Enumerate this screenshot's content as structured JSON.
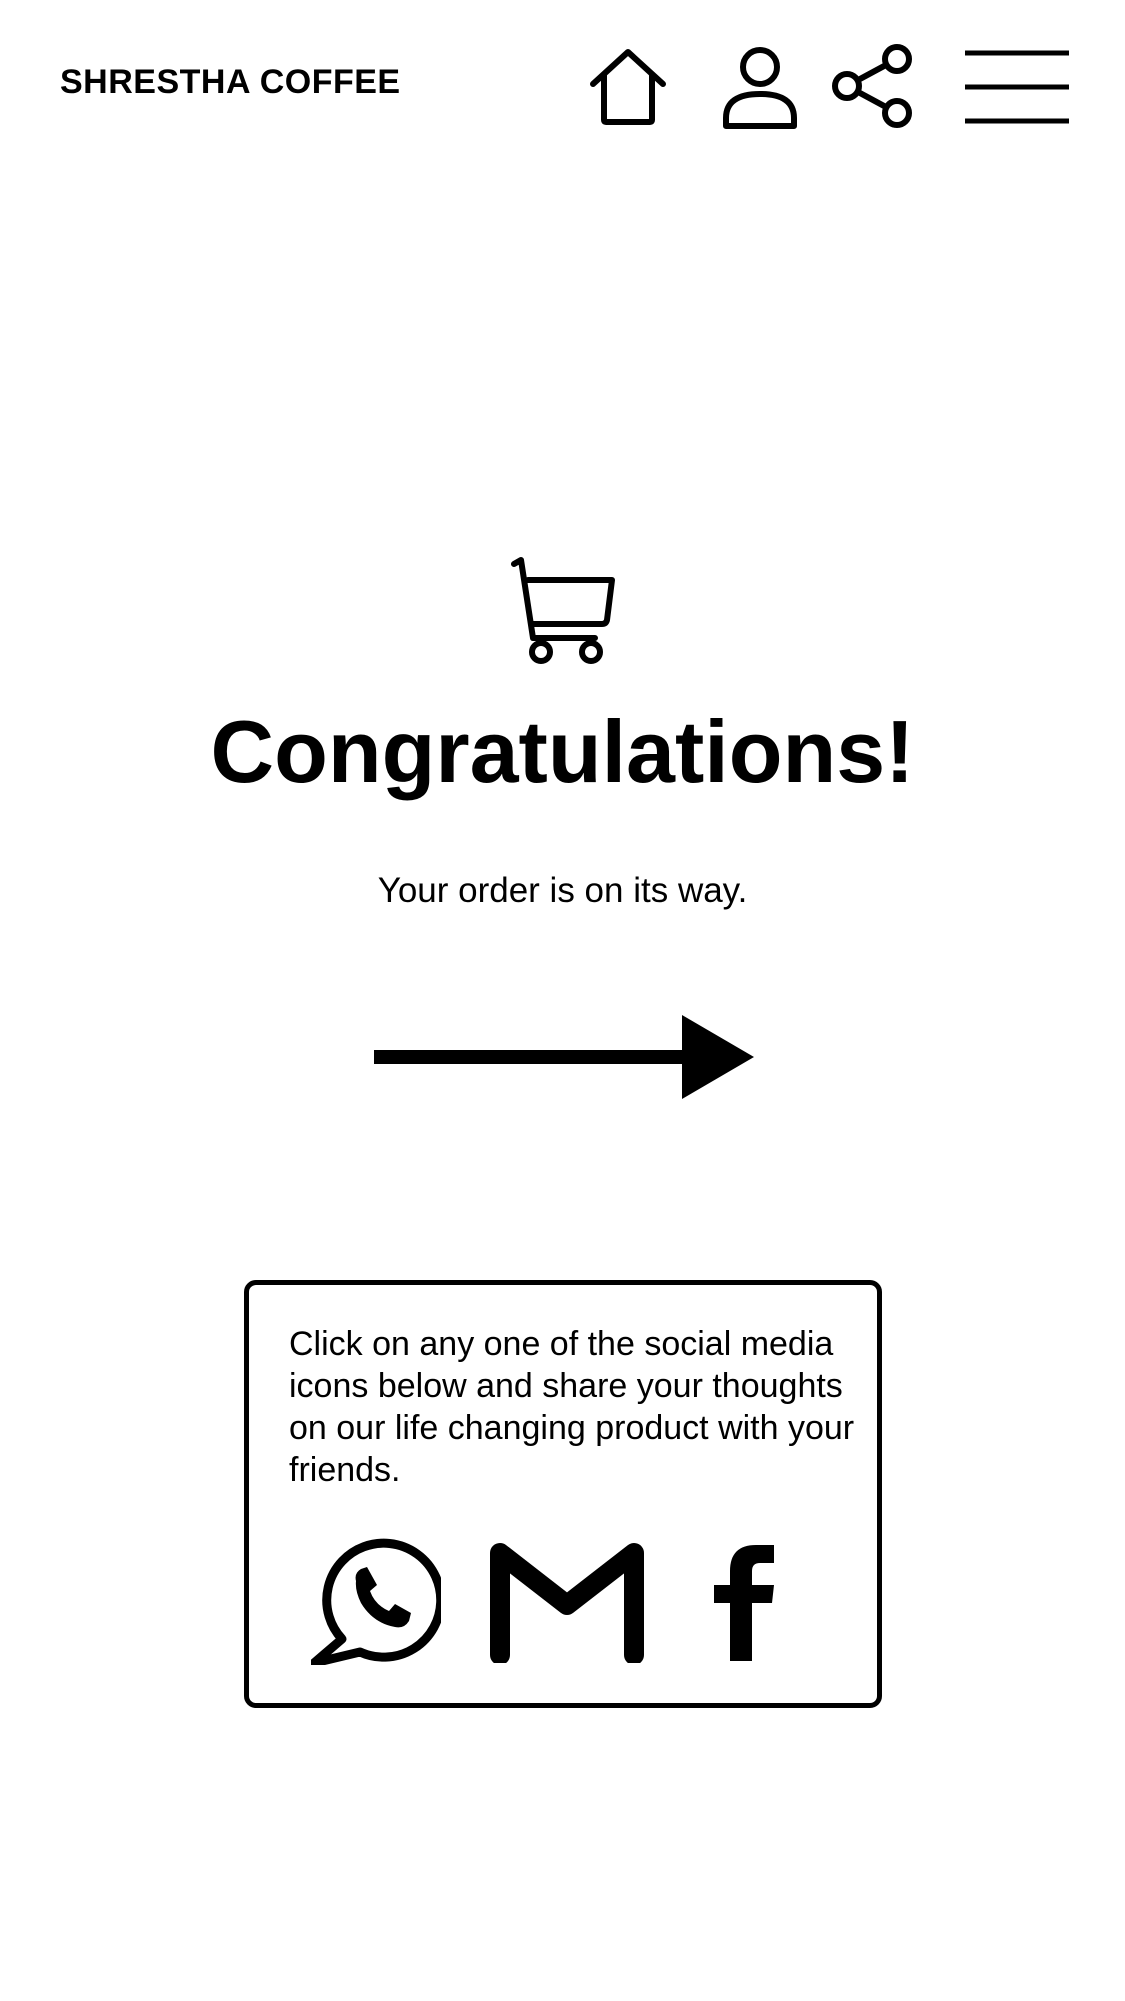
{
  "header": {
    "brand": "SHRESTHA COFFEE",
    "icons": {
      "home": "home-icon",
      "user": "user-icon",
      "share": "share-icon",
      "menu": "hamburger-menu-icon"
    }
  },
  "main": {
    "cart_icon": "shopping-cart-icon",
    "title": "Congratulations!",
    "subtitle": "Your order is on its way.",
    "arrow_icon": "arrow-right-icon"
  },
  "share_card": {
    "text": "Click on any one of the social media icons below and share your thoughts on our life changing product with your friends.",
    "icons": [
      "whatsapp-icon",
      "gmail-icon",
      "facebook-icon"
    ]
  },
  "colors": {
    "foreground": "#000000",
    "background": "#ffffff"
  }
}
